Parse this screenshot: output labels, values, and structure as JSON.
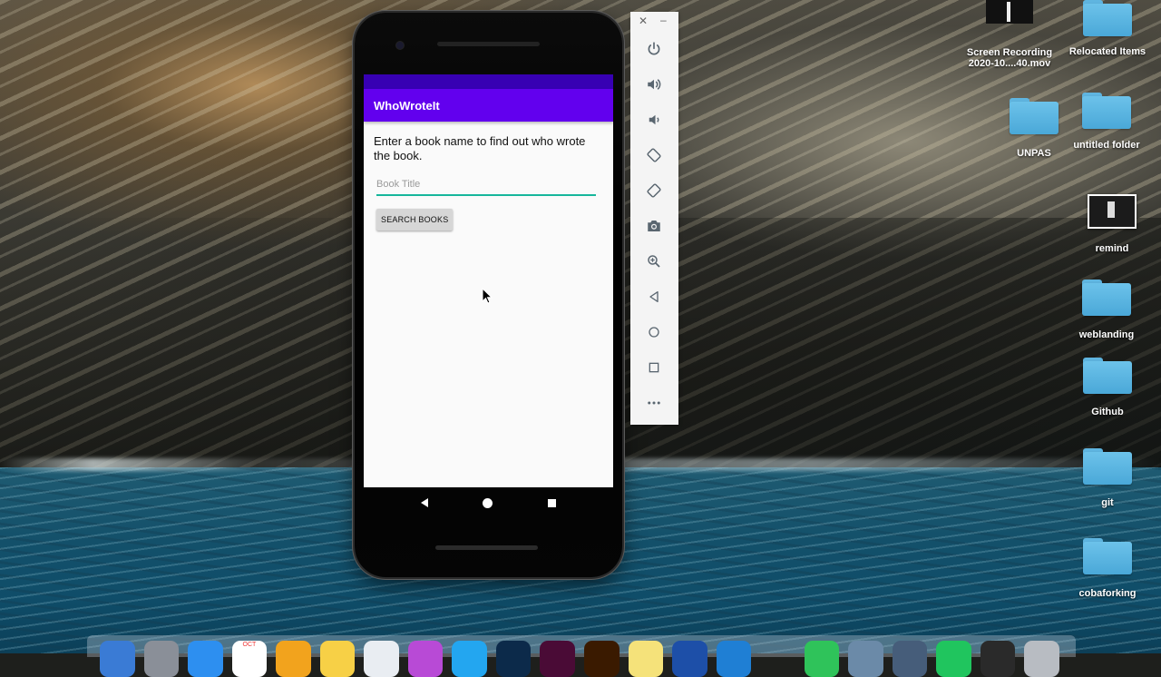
{
  "app": {
    "title": "WhoWroteIt",
    "prompt": "Enter a book name to find out who wrote the book.",
    "search": {
      "placeholder": "Book Title",
      "value": ""
    },
    "search_button": "SEARCH BOOKS"
  },
  "colors": {
    "primary": "#6200ee",
    "primary_dark": "#3700b3",
    "accent": "#16b69b"
  },
  "emulator_toolbar": {
    "buttons": [
      "power-icon",
      "volume-up-icon",
      "volume-down-icon",
      "rotate-left-icon",
      "rotate-right-icon",
      "camera-icon",
      "zoom-icon",
      "back-icon",
      "home-icon",
      "overview-icon",
      "more-icon"
    ]
  },
  "desktop": {
    "items": [
      {
        "label": "Screen Recording\n2020-10....40.mov",
        "line1": "Screen Recording",
        "line2": "2020-10....40.mov",
        "kind": "video"
      },
      {
        "label": "Relocated Items",
        "kind": "folder"
      },
      {
        "label": "UNPAS",
        "kind": "folder"
      },
      {
        "label": "untitled folder",
        "kind": "folder"
      },
      {
        "label": "remind",
        "kind": "document"
      },
      {
        "label": "weblanding",
        "kind": "folder"
      },
      {
        "label": "Github",
        "kind": "folder"
      },
      {
        "label": "git",
        "kind": "folder"
      },
      {
        "label": "cobaforking",
        "kind": "folder"
      }
    ]
  },
  "dock": {
    "calendar_month": "OCT"
  }
}
